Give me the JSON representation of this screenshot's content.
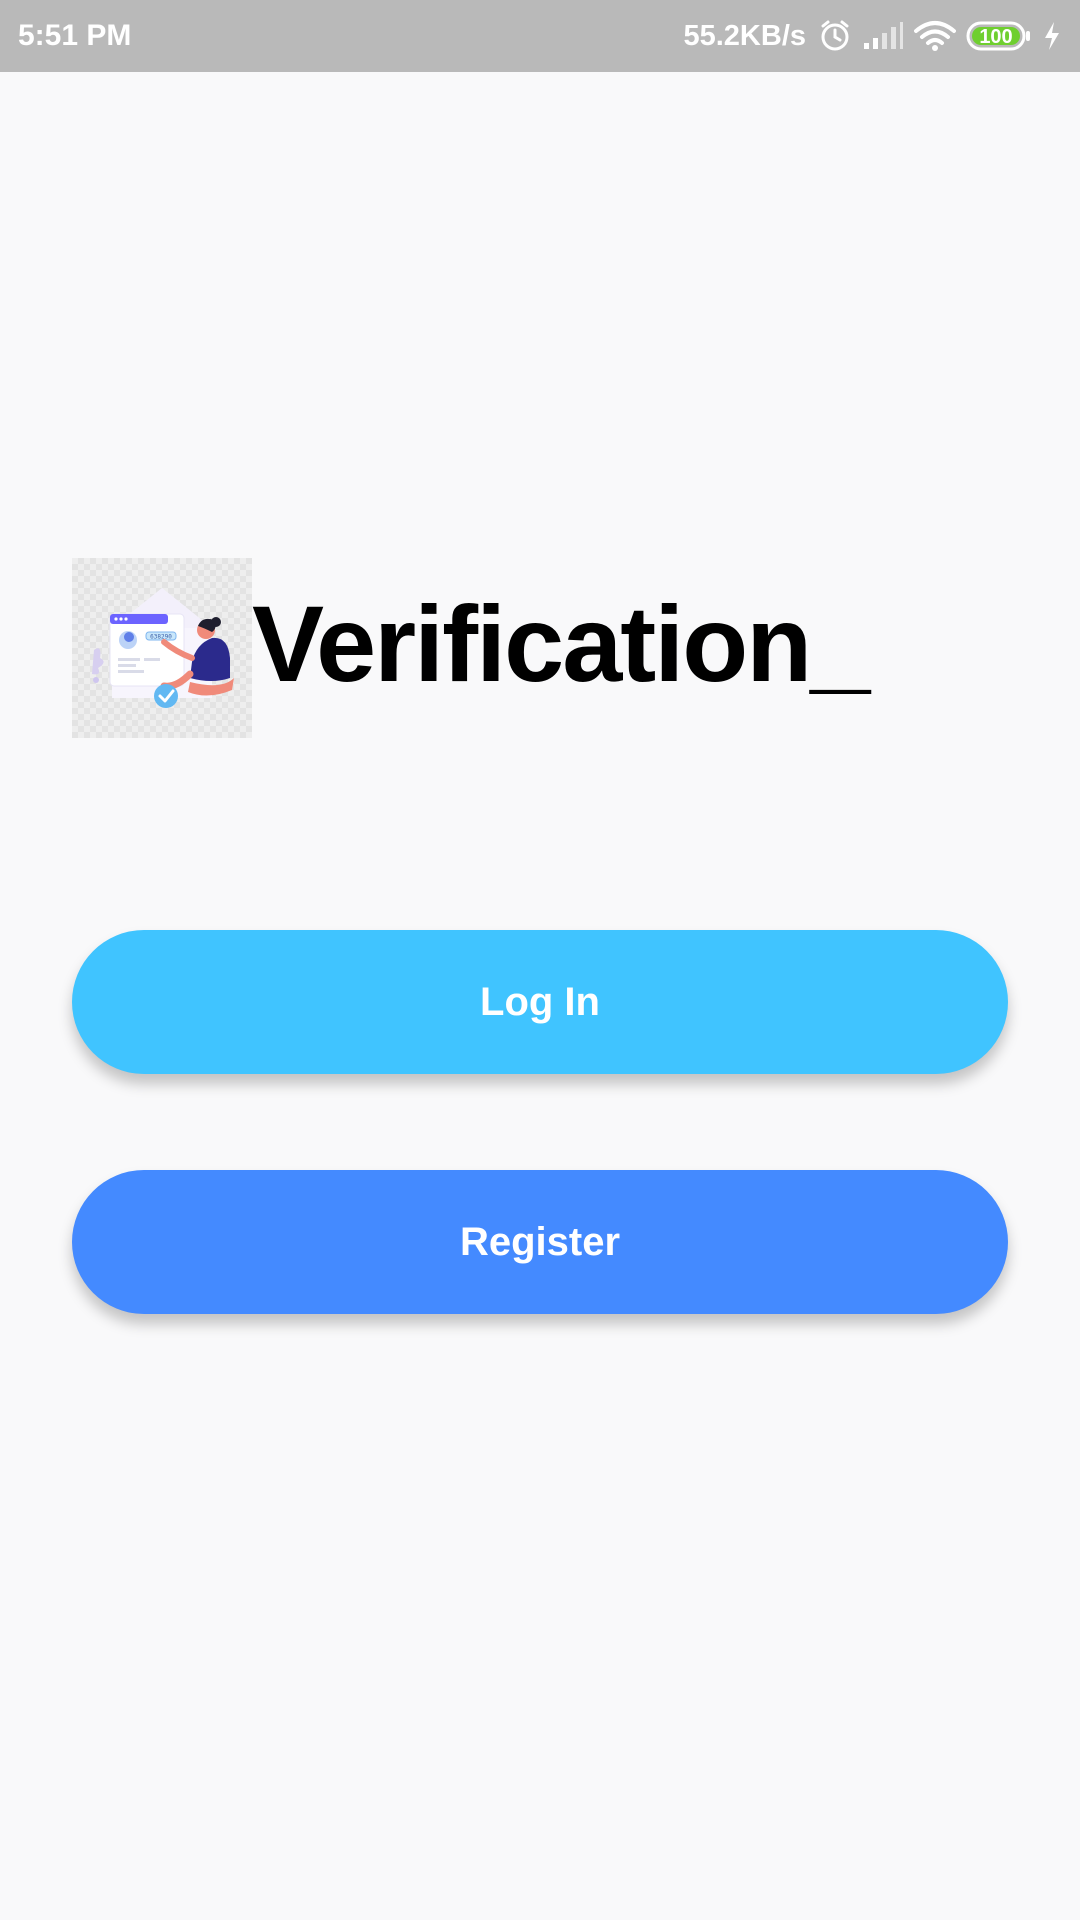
{
  "status_bar": {
    "time": "5:51 PM",
    "net_speed": "55.2KB/s",
    "battery_level": "100",
    "icons": [
      "alarm-icon",
      "signal-icon",
      "wifi-icon",
      "battery-icon",
      "charging-icon"
    ]
  },
  "app": {
    "logo_icon": "verification-illustration-icon",
    "logo_badge": "638290",
    "title": "Verification_"
  },
  "actions": {
    "login_label": "Log In",
    "register_label": "Register"
  },
  "colors": {
    "status_bar_bg": "#b9b9b9",
    "page_bg": "#f9f9fa",
    "login_button": "#40c4ff",
    "register_button": "#448aff",
    "battery_fill": "#6fcf2f"
  }
}
